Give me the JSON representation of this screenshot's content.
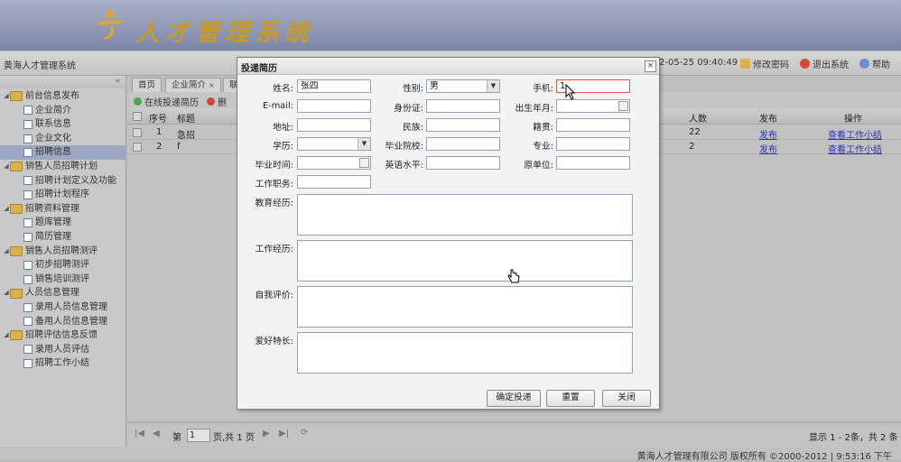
{
  "banner": {
    "title": "人才管理系统"
  },
  "topbar": {
    "system_name": "黄海人才管理系统",
    "datetime": "2-05-25 09:40:49",
    "change_password": "修改密码",
    "logout": "退出系统",
    "help": "帮助"
  },
  "nav": {
    "groups": [
      {
        "label": "前台信息发布",
        "items": [
          "企业简介",
          "联系信息",
          "企业文化",
          "招聘信息"
        ]
      },
      {
        "label": "销售人员招聘计划",
        "items": [
          "招聘计划定义及功能",
          "招聘计划程序"
        ]
      },
      {
        "label": "招聘资料管理",
        "items": [
          "题库管理",
          "简历管理"
        ]
      },
      {
        "label": "销售人员招聘测评",
        "items": [
          "初步招聘测评",
          "销售培训测评"
        ]
      },
      {
        "label": "人员信息管理",
        "items": [
          "录用人员信息管理",
          "备用人员信息管理"
        ]
      },
      {
        "label": "招聘评估信息反馈",
        "items": [
          "录用人员评估",
          "招聘工作小结"
        ]
      }
    ],
    "selected": "招聘信息"
  },
  "tabs": {
    "home": "首页",
    "company": "企业简介",
    "third": "联"
  },
  "toolbar": {
    "apply_online": "在线投递简历",
    "delete": "删"
  },
  "grid": {
    "headers": {
      "seq": "序号",
      "title": "标题",
      "count": "人数",
      "publish": "发布",
      "action": "操作"
    },
    "rows": [
      {
        "seq": "1",
        "title": "急招",
        "count": "22",
        "publish": "发布",
        "action": "查看工作小结"
      },
      {
        "seq": "2",
        "title": "f",
        "count": "2",
        "publish": "发布",
        "action": "查看工作小结"
      }
    ]
  },
  "pager": {
    "page_label": "第",
    "page_value": "1",
    "page_total": "页,共 1 页",
    "display_info": "显示 1 - 2条，共 2 条"
  },
  "status": {
    "text": "黄海人才管理有限公司 版权所有 ©2000-2012  |  9:53:16 下午"
  },
  "dialog": {
    "title": "投递简历",
    "close": "×",
    "labels": {
      "name": "姓名:",
      "gender": "性别:",
      "mobile": "手机:",
      "email": "E-mail:",
      "idcard": "身份证:",
      "birth": "出生年月:",
      "address": "地址:",
      "ethnic": "民族:",
      "native": "籍贯:",
      "education": "学历:",
      "school": "毕业院校:",
      "major": "专业:",
      "grad_time": "毕业时间:",
      "english": "英语水平:",
      "former_unit": "原单位:",
      "position": "工作职务:",
      "edu_history": "教育经历:",
      "work_history": "工作经历:",
      "self_eval": "自我评价:",
      "hobbies": "爱好特长:"
    },
    "values": {
      "name": "张四",
      "gender": "男",
      "mobile": "1"
    },
    "buttons": {
      "submit": "确定投递",
      "reset": "重置",
      "close": "关闭"
    }
  },
  "colors": {
    "accent": "#c59a2a",
    "link": "#2d2dbb",
    "focus_border": "#e2534a"
  }
}
